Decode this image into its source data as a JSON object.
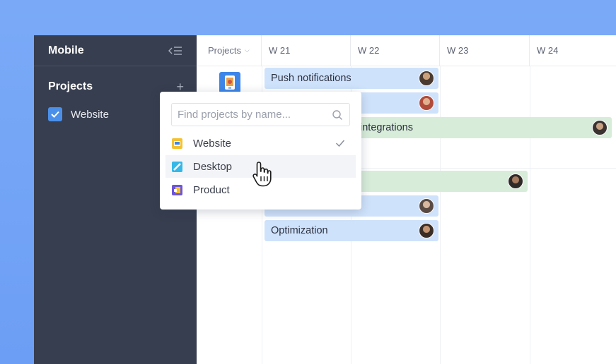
{
  "sidebar": {
    "title": "Mobile",
    "projects_heading": "Projects",
    "projects": [
      {
        "label": "Website",
        "checked": true
      }
    ]
  },
  "timeline": {
    "projects_column": "Projects",
    "weeks": [
      "W 21",
      "W 22",
      "W 23",
      "W 24"
    ],
    "bars": [
      {
        "label": "Push notifications"
      },
      {
        "label": ""
      },
      {
        "label": "integrations"
      },
      {
        "label": ""
      },
      {
        "label": ""
      },
      {
        "label": "Optimization"
      }
    ]
  },
  "dropdown": {
    "search_placeholder": "Find projects by name...",
    "items": [
      {
        "label": "Website",
        "selected": true
      },
      {
        "label": "Desktop",
        "hovered": true
      },
      {
        "label": "Product"
      }
    ]
  },
  "colors": {
    "sidebar_bg": "#373e4f",
    "accent_blue": "#4a90ea",
    "bar_blue": "#cfe2fb",
    "bar_green": "#d7ecd9",
    "background": "#6c9ef5"
  }
}
